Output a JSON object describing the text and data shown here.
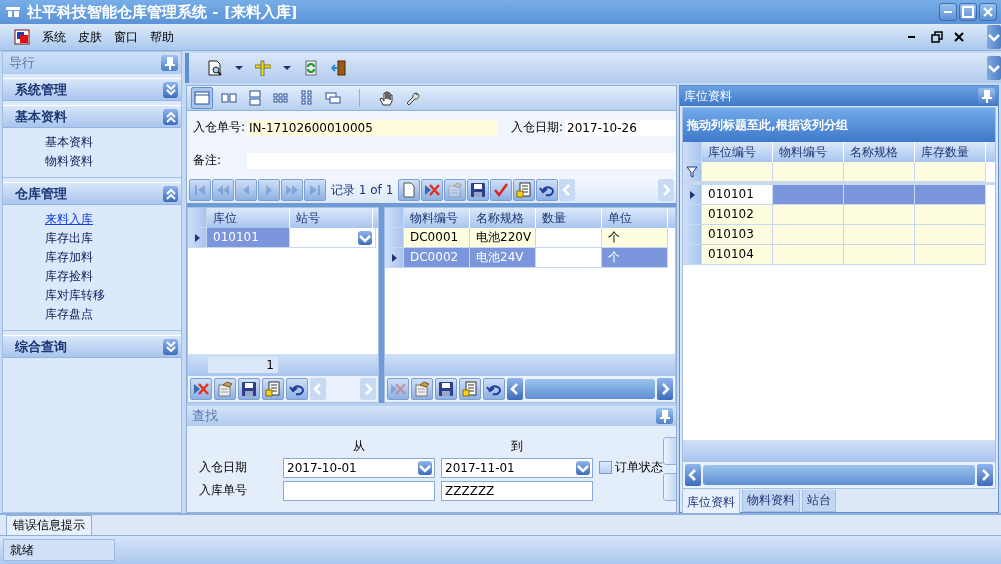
{
  "window": {
    "title": "社平科技智能仓库管理系统 - [来料入库]"
  },
  "menu": [
    {
      "label": "系统"
    },
    {
      "label": "皮肤"
    },
    {
      "label": "窗口"
    },
    {
      "label": "帮助"
    }
  ],
  "nav": {
    "title": "导行",
    "groups": [
      {
        "label": "系统管理",
        "expanded": false
      },
      {
        "label": "基本资料",
        "expanded": true,
        "items": [
          {
            "label": "基本资料",
            "selected": false
          },
          {
            "label": "物料资料",
            "selected": false
          }
        ]
      },
      {
        "label": "仓库管理",
        "expanded": true,
        "items": [
          {
            "label": "来料入库",
            "selected": true
          },
          {
            "label": "库存出库",
            "selected": false
          },
          {
            "label": "库存加料",
            "selected": false
          },
          {
            "label": "库存捡料",
            "selected": false
          },
          {
            "label": "库对库转移",
            "selected": false
          },
          {
            "label": "库存盘点",
            "selected": false
          }
        ]
      },
      {
        "label": "综合查询",
        "expanded": false
      }
    ]
  },
  "form": {
    "order_no": {
      "label": "入仓单号:",
      "value": "IN-17102600010005"
    },
    "date": {
      "label": "入仓日期:",
      "value": "2017-10-26"
    },
    "remark": {
      "label": "备注:"
    }
  },
  "navigator": {
    "text": "记录 1 of 1",
    "buttons": [
      {
        "disabled": true
      },
      {
        "disabled": true
      },
      {
        "disabled": true
      },
      {
        "disabled": true
      },
      {
        "disabled": true
      },
      {
        "disabled": true
      },
      {
        "disabled": false
      },
      {
        "disabled": false
      },
      {
        "disabled": true
      },
      {
        "disabled": false
      },
      {
        "disabled": false
      },
      {
        "disabled": false
      },
      {
        "disabled": false
      }
    ]
  },
  "location_grid": {
    "columns": [
      "库位",
      "站号"
    ],
    "rows": [
      {
        "location": "010101",
        "selected": true
      }
    ],
    "footer": "1",
    "buttons": [
      {
        "disabled": false
      },
      {
        "disabled": false
      },
      {
        "disabled": false
      },
      {
        "disabled": false
      },
      {
        "disabled": false
      }
    ]
  },
  "material_grid": {
    "columns": [
      "物料编号",
      "名称规格",
      "数量",
      "单位"
    ],
    "rows": [
      {
        "code": "DC0001",
        "name": "电池220V",
        "unit": "个",
        "selected": false
      },
      {
        "code": "DC0002",
        "name": "电池24V",
        "unit": "个",
        "selected": true
      }
    ],
    "buttons": [
      {
        "disabled": true
      },
      {
        "disabled": false
      },
      {
        "disabled": false
      },
      {
        "disabled": false
      },
      {
        "disabled": false
      }
    ]
  },
  "search": {
    "title": "查找",
    "from_label": "从",
    "to_label": "到",
    "rows": [
      {
        "label": "入仓日期",
        "kind": "date",
        "from": "2017-10-01",
        "to": "2017-11-01"
      },
      {
        "label": "入库单号",
        "kind": "text",
        "to": "ZZZZZZ"
      }
    ],
    "checkbox": {
      "label": "订单状态",
      "checked": false
    }
  },
  "dock": {
    "title": "库位资料",
    "group_hint": "拖动列标题至此,根据该列分组",
    "columns": [
      "库位编号",
      "物料编号",
      "名称规格",
      "库存数量"
    ],
    "rows": [
      {
        "location": "010101",
        "selected": true
      },
      {
        "location": "010102",
        "selected": false
      },
      {
        "location": "010103",
        "selected": false
      },
      {
        "location": "010104",
        "selected": false
      }
    ],
    "tabs": [
      {
        "label": "库位资料",
        "selected": true
      },
      {
        "label": "物料资料",
        "selected": false
      },
      {
        "label": "站台",
        "selected": false
      }
    ]
  },
  "error_tab": {
    "label": "错误信息提示"
  },
  "status_bar": {
    "text": "就绪"
  }
}
